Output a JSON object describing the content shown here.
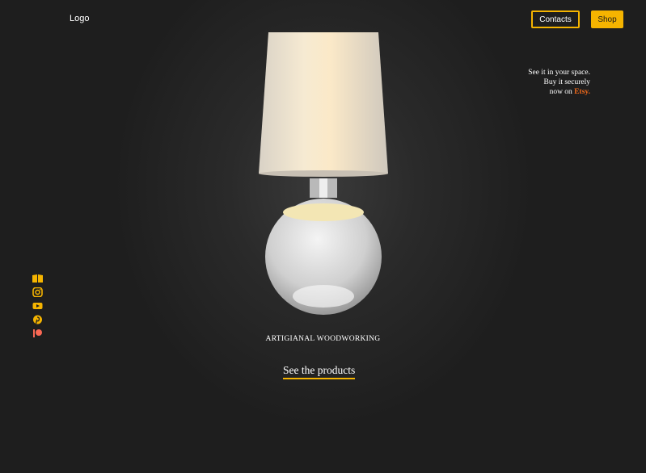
{
  "header": {
    "logo_text": "Logo",
    "contacts_label": "Contacts",
    "shop_label": "Shop"
  },
  "promo": {
    "line1": "See it in your space.",
    "line2": "Buy it securely",
    "line3_prefix": "now on ",
    "line3_brand": "Etsy."
  },
  "social": [
    {
      "icon": "book-icon"
    },
    {
      "icon": "instagram-icon"
    },
    {
      "icon": "youtube-icon"
    },
    {
      "icon": "pinterest-icon"
    },
    {
      "icon": "patreon-icon"
    }
  ],
  "hero": {
    "tagline": "ARTIGIANAL WOODWORKING",
    "cta_label": "See the products"
  },
  "colors": {
    "accent": "#f5b400",
    "etsy": "#f26a1b",
    "background": "#1e1e1e",
    "patreon": "#f96854"
  }
}
